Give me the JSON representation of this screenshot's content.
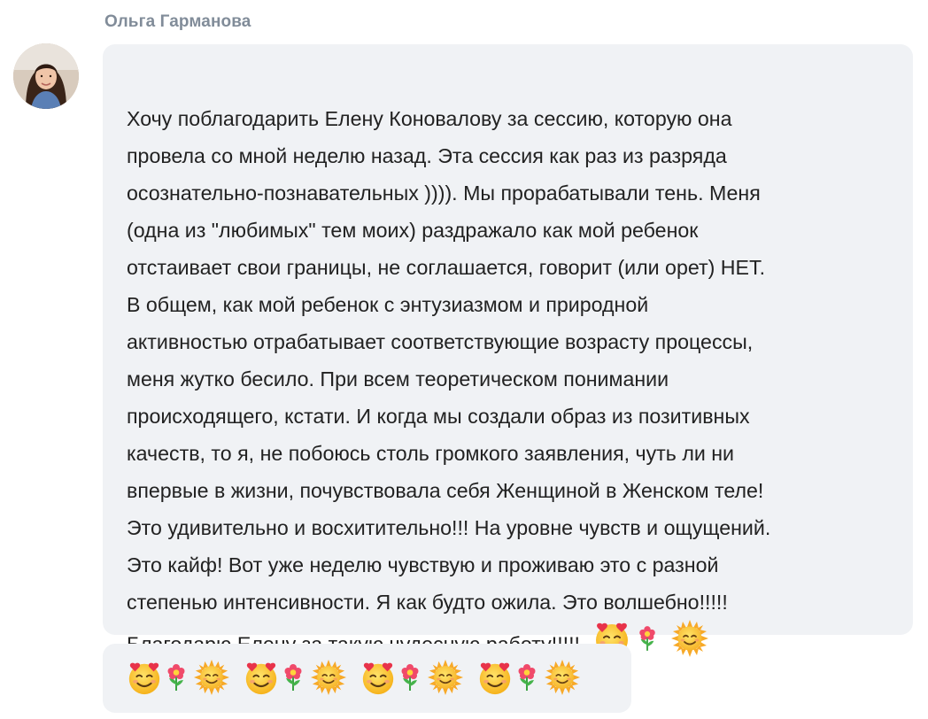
{
  "post": {
    "author": "Ольга Гарманова",
    "text_lines": [
      "Хочу поблагодарить Елену Коновалову за сессию, которую она",
      "провела со мной неделю назад. Эта сессия как раз из разряда",
      "осознательно-познавательных )))). Мы прорабатывали тень. Меня",
      "(одна из \"любимых\" тем моих) раздражало как мой ребенок",
      "отстаивает свои границы, не соглашается, говорит (или орет) НЕТ.",
      "В общем, как мой ребенок с энтузиазмом и природной",
      "активностью отрабатывает соответствующие возрасту процессы,",
      "меня жутко бесило. При всем теоретическом понимании",
      "происходящего, кстати. И когда мы создали образ из позитивных",
      "качеств, то я, не побоюсь столь громкого заявления, чуть ли ни",
      "впервые в жизни, почувствовала себя Женщиной в Женском теле!",
      "Это удивительно и восхитительно!!! На уровне чувств и ощущений.",
      "Это кайф! Вот уже неделю чувствую и проживаю это с разной",
      "степенью интенсивности. Я как будто ожила. Это волшебно!!!!!",
      "Благодарю Елену за такую чудесную работу!!!!!"
    ],
    "inline_emojis": [
      "smiling-face-with-heart-eyes-icon",
      "flower-icon",
      "sun-with-face-icon"
    ]
  },
  "second_message": {
    "emoji_groups": 4,
    "emojis": [
      "smiling-face-with-heart-eyes-icon",
      "flower-icon",
      "sun-with-face-icon"
    ]
  }
}
